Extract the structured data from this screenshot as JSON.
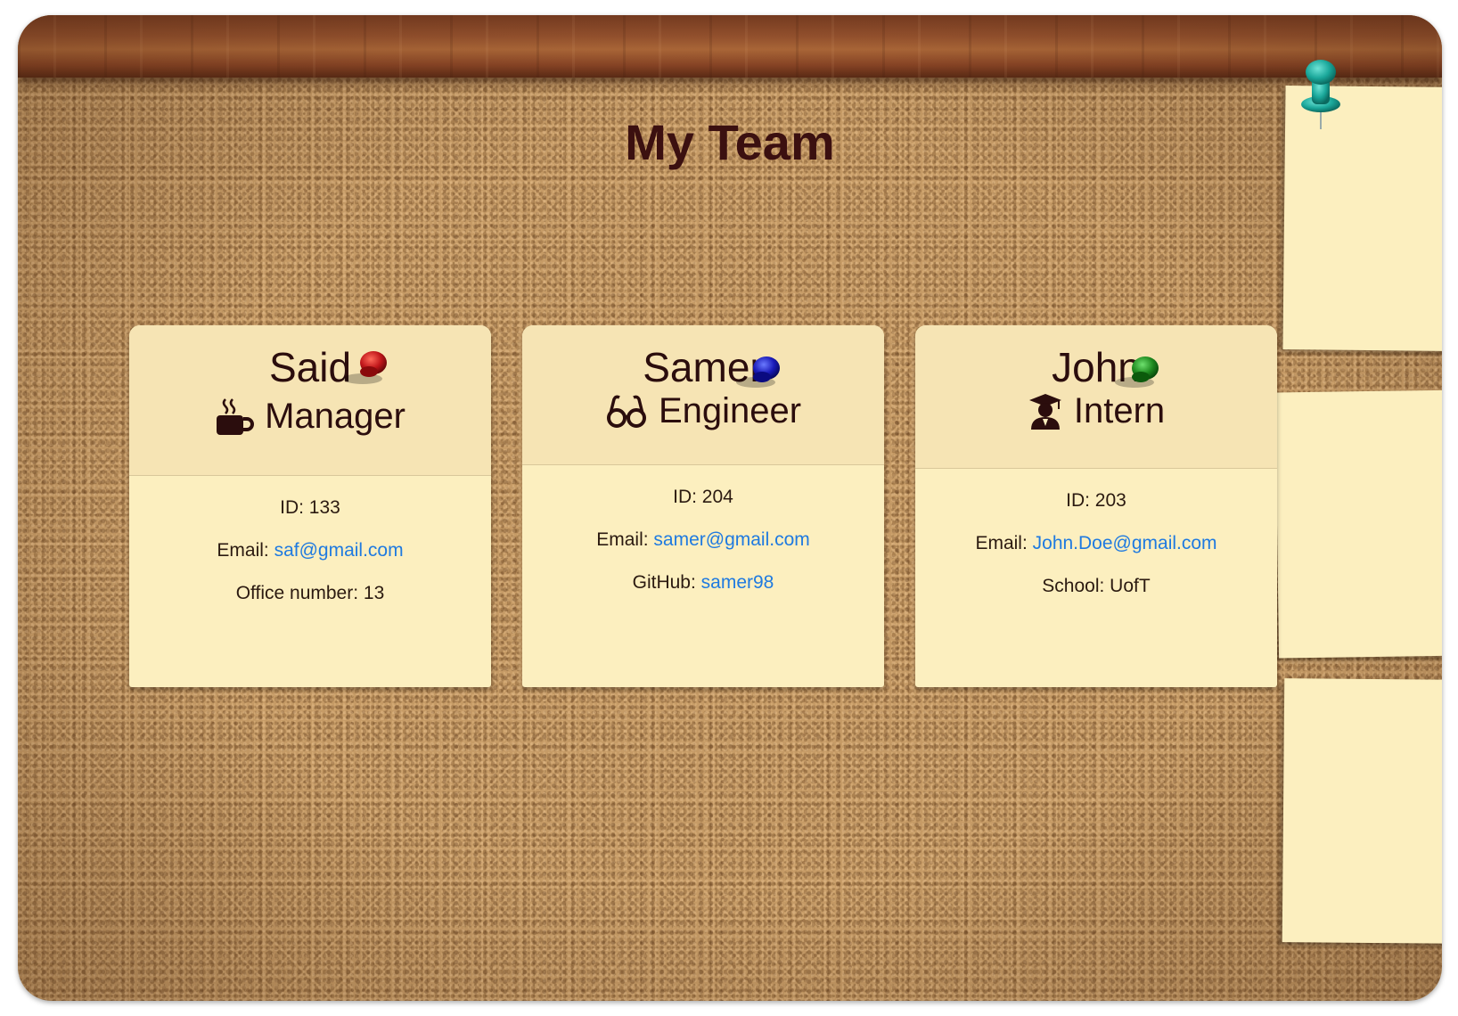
{
  "header": {
    "title": "My Team"
  },
  "cards": [
    {
      "name": "Said",
      "role": "Manager",
      "role_icon": "coffee-mug-icon",
      "pin_color": "#c0161a",
      "id_label": "ID: 133",
      "email_label": "Email: ",
      "email": "saf@gmail.com",
      "extra_label": "Office number: 13",
      "extra_value": ""
    },
    {
      "name": "Samer",
      "role": "Engineer",
      "role_icon": "glasses-icon",
      "pin_color": "#1a1ab8",
      "id_label": "ID: 204",
      "email_label": "Email: ",
      "email": "samer@gmail.com",
      "extra_label": "GitHub: ",
      "extra_value": "samer98"
    },
    {
      "name": "John",
      "role": "Intern",
      "role_icon": "graduate-icon",
      "pin_color": "#1f8a1f",
      "id_label": "ID: 203",
      "email_label": "Email: ",
      "email": "John.Doe@gmail.com",
      "extra_label": "School: UofT",
      "extra_value": ""
    }
  ],
  "colors": {
    "cork": "#c69b66",
    "card_bg": "#fcefbf",
    "card_header_bg": "#f6e4b4",
    "title_text": "#3b1010",
    "link": "#1f7ae0",
    "teal_pin": "#1aa79a"
  }
}
